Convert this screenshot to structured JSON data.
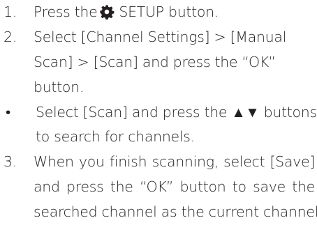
{
  "steps": [
    {
      "marker": "1.",
      "lines": [
        "Press the",
        "SETUP button."
      ]
    },
    {
      "marker": "2.",
      "lines": [
        "Select [Channel Settings] > [Manual",
        "Scan] > [Scan] and press the “OK”",
        "button."
      ]
    },
    {
      "marker": "•",
      "lines": [
        "Select [Scan] and press the ▲▼ buttons",
        "to search for channels."
      ]
    },
    {
      "marker": "3.",
      "lines": [
        "When you finish scanning, select [Save]",
        "and press the “OK” button to save the",
        "searched channel as the current channel."
      ]
    }
  ],
  "icons": {
    "setup": "gear-icon"
  }
}
